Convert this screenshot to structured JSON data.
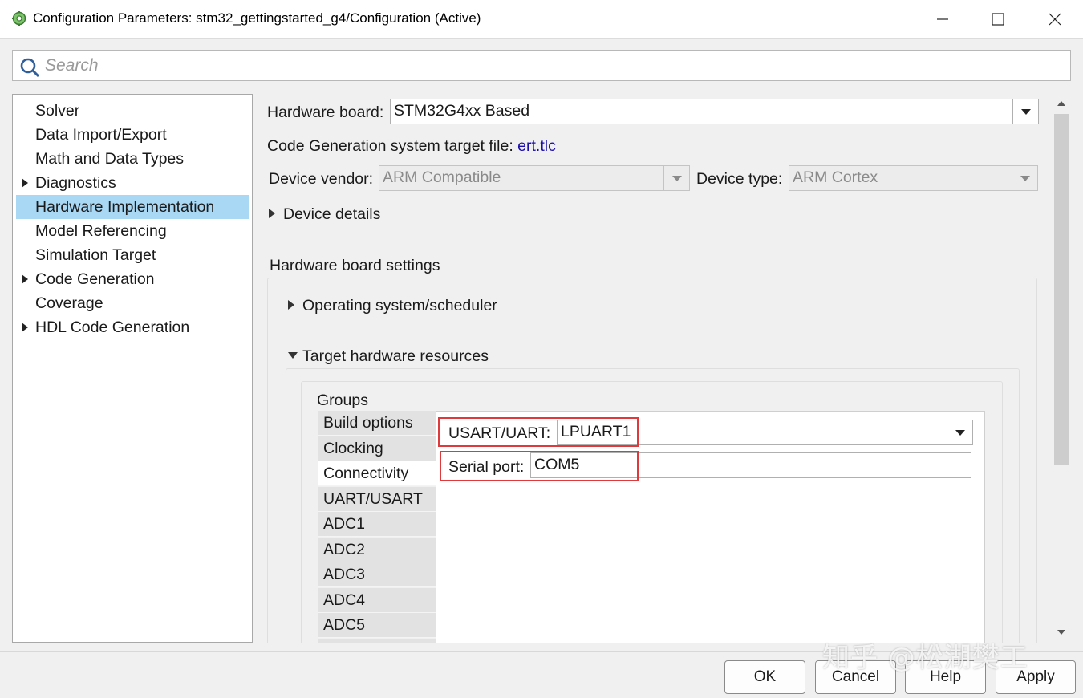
{
  "window": {
    "title": "Configuration Parameters: stm32_gettingstarted_g4/Configuration (Active)",
    "icon": "gear-model-icon",
    "controls": [
      "minimize-icon",
      "maximize-icon",
      "close-icon"
    ]
  },
  "search": {
    "placeholder": "Search",
    "value": ""
  },
  "nav": {
    "items": [
      {
        "label": "Solver",
        "expandable": false,
        "selected": false
      },
      {
        "label": "Data Import/Export",
        "expandable": false,
        "selected": false
      },
      {
        "label": "Math and Data Types",
        "expandable": false,
        "selected": false
      },
      {
        "label": "Diagnostics",
        "expandable": true,
        "selected": false
      },
      {
        "label": "Hardware Implementation",
        "expandable": false,
        "selected": true
      },
      {
        "label": "Model Referencing",
        "expandable": false,
        "selected": false
      },
      {
        "label": "Simulation Target",
        "expandable": false,
        "selected": false
      },
      {
        "label": "Code Generation",
        "expandable": true,
        "selected": false
      },
      {
        "label": "Coverage",
        "expandable": false,
        "selected": false
      },
      {
        "label": "HDL Code Generation",
        "expandable": true,
        "selected": false
      }
    ]
  },
  "hardware": {
    "board_label": "Hardware board:",
    "board_value": "STM32G4xx Based",
    "target_file_label": "Code Generation system target file:",
    "target_file_link": "ert.tlc",
    "vendor_label": "Device vendor:",
    "vendor_value": "ARM Compatible",
    "type_label": "Device type:",
    "type_value": "ARM Cortex",
    "device_details": "Device details",
    "board_settings_title": "Hardware board settings",
    "os_scheduler": "Operating system/scheduler",
    "target_resources": "Target hardware resources",
    "groups_label": "Groups",
    "groups": [
      {
        "label": "Build options",
        "active": false
      },
      {
        "label": "Clocking",
        "active": false
      },
      {
        "label": "Connectivity",
        "active": true
      },
      {
        "label": "UART/USART",
        "active": false
      },
      {
        "label": "ADC1",
        "active": false
      },
      {
        "label": "ADC2",
        "active": false
      },
      {
        "label": "ADC3",
        "active": false
      },
      {
        "label": "ADC4",
        "active": false
      },
      {
        "label": "ADC5",
        "active": false
      }
    ],
    "usart_label": "USART/UART:",
    "usart_value": "LPUART1",
    "serial_label": "Serial port:",
    "serial_value": "COM5"
  },
  "highlight_color": "#e0393b",
  "selection_color": "#a9d8f5",
  "buttons": {
    "ok": "OK",
    "cancel": "Cancel",
    "help": "Help",
    "apply": "Apply"
  },
  "watermark": "知乎 @松湖樊工"
}
